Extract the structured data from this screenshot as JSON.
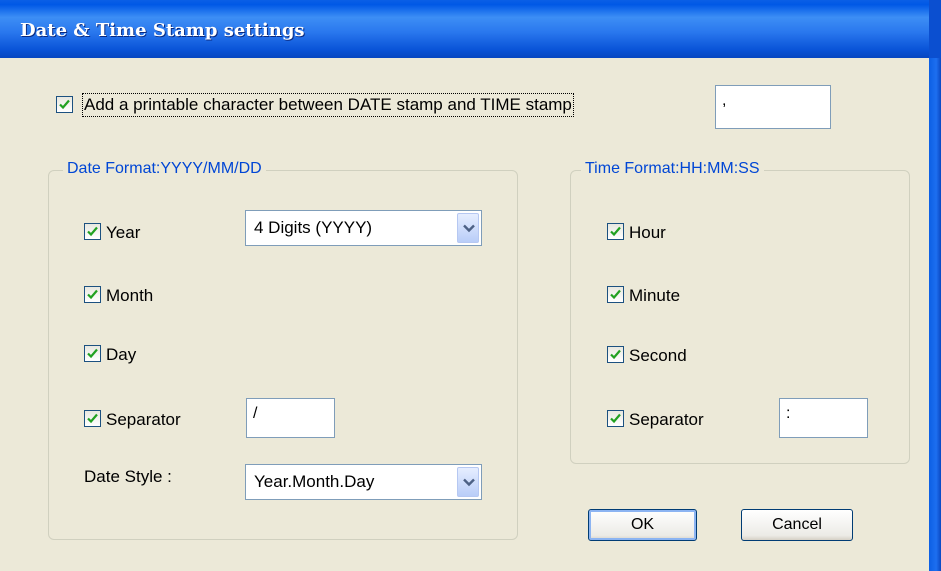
{
  "window": {
    "title": "Date & Time Stamp settings"
  },
  "main": {
    "add_char_label": "Add a printable character between DATE stamp and TIME stamp",
    "add_char_checked": true,
    "add_char_value": ","
  },
  "date_group": {
    "title": "Date Format:YYYY/MM/DD",
    "year_label": "Year",
    "year_checked": true,
    "year_format": "4 Digits (YYYY)",
    "month_label": "Month",
    "month_checked": true,
    "day_label": "Day",
    "day_checked": true,
    "separator_label": "Separator",
    "separator_checked": true,
    "separator_value": "/",
    "date_style_label": "Date Style :",
    "date_style_value": "Year.Month.Day"
  },
  "time_group": {
    "title": "Time Format:HH:MM:SS",
    "hour_label": "Hour",
    "hour_checked": true,
    "minute_label": "Minute",
    "minute_checked": true,
    "second_label": "Second",
    "second_checked": true,
    "separator_label": "Separator",
    "separator_checked": true,
    "separator_value": ":"
  },
  "buttons": {
    "ok": "OK",
    "cancel": "Cancel"
  },
  "icons": {
    "checkmark": "check-icon",
    "dropdown": "chevron-down-icon"
  },
  "colors": {
    "accent": "#0046d5",
    "titlebar": "#0058e6",
    "face": "#ece9d8"
  }
}
